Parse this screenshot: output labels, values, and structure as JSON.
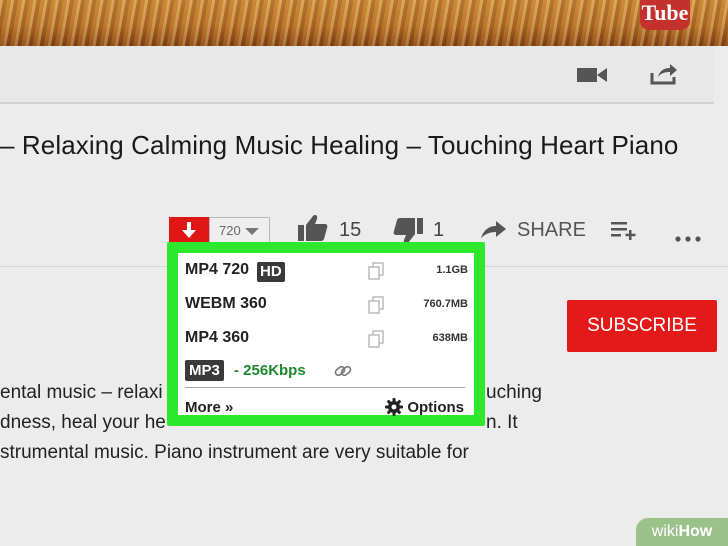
{
  "video": {
    "logo_text": "Tube"
  },
  "player_bar": {
    "icons": [
      "video-camera-icon",
      "share-arrow-icon"
    ]
  },
  "title": "– Relaxing Calming Music Healing – Touching Heart Piano",
  "actions": {
    "resolution_value": "720",
    "like_count": "15",
    "dislike_count": "1",
    "share_label": "SHARE",
    "icons": [
      "download-arrow-icon",
      "thumbs-up-icon",
      "thumbs-down-icon",
      "share-arrow-icon",
      "add-to-playlist-icon",
      "more-dots-icon"
    ]
  },
  "subscribe": {
    "label": "SUBSCRIBE"
  },
  "description": {
    "line1_left": "ental music – relaxi",
    "line1_right": "uching",
    "line2_left": "dness, heal your he",
    "line2_right": "n. It",
    "line3": "strumental music. Piano instrument are very suitable for"
  },
  "download_popup": {
    "rows": [
      {
        "label": "MP4 720",
        "badge": "HD",
        "size": "1.1GB"
      },
      {
        "label": "WEBM 360",
        "badge": "",
        "size": "760.7MB"
      },
      {
        "label": "MP4 360",
        "badge": "",
        "size": "638MB"
      }
    ],
    "mp3": {
      "badge": "MP3",
      "rate": "- 256Kbps"
    },
    "more_label": "More »",
    "options_label": "Options",
    "colors": {
      "highlight_border": "#2ee82e",
      "mp3_rate": "#1e8a2e"
    },
    "icons": [
      "copy-icon",
      "link-icon",
      "gear-icon"
    ]
  },
  "watermark": {
    "wiki": "wiki",
    "how": "How"
  },
  "colors": {
    "download_red": "#e01515",
    "subscribe_red": "#e41a1a"
  }
}
